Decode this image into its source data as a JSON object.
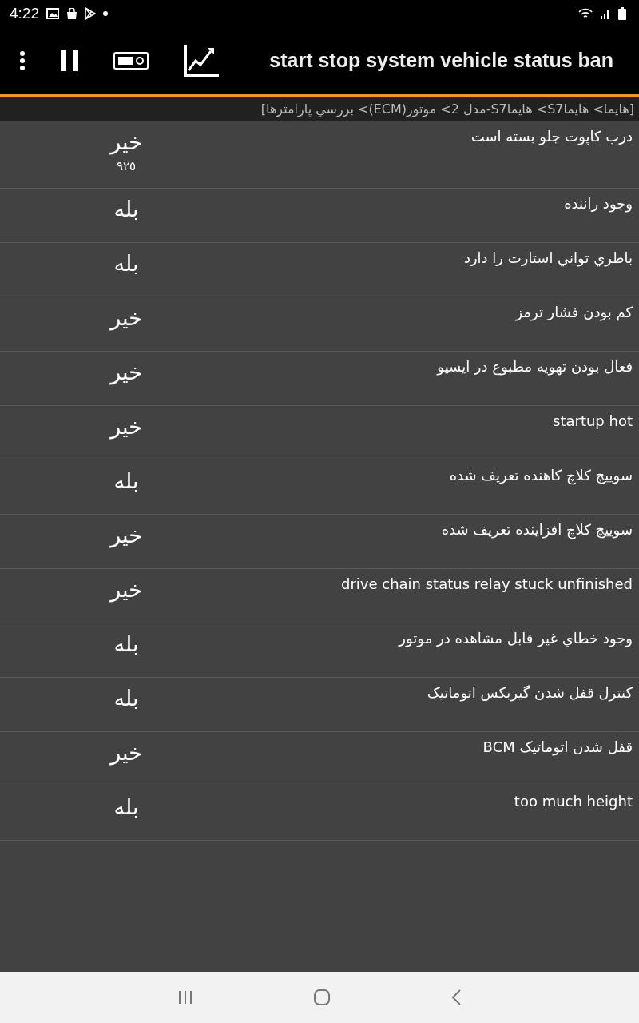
{
  "status_bar": {
    "time": "4:22"
  },
  "toolbar": {
    "title": "start stop system vehicle status ban"
  },
  "breadcrumb": "[هايما> هايماS7> هايماS7-مدل 2> موتور(ECM)> بررسي پارامترها]",
  "parameters": [
    {
      "name": "درب کاپوت جلو بسته است",
      "value": "خير",
      "sub": "٩٢٥"
    },
    {
      "name": "وجود راننده",
      "value": "بله"
    },
    {
      "name": "باطري تواني استارت را دارد",
      "value": "بله"
    },
    {
      "name": "کم بودن فشار ترمز",
      "value": "خير"
    },
    {
      "name": "فعال بودن تهويه مطبوع در ايسيو",
      "value": "خير"
    },
    {
      "name": "startup hot",
      "value": "خير"
    },
    {
      "name": "سوييچ کلاچ کاهنده تعريف شده",
      "value": "بله"
    },
    {
      "name": "سوييچ کلاچ افزاينده تعريف شده",
      "value": "خير"
    },
    {
      "name": "drive chain status relay stuck unfinished",
      "value": "خير"
    },
    {
      "name": "وجود خطاي غير قابل مشاهده در موتور",
      "value": "بله"
    },
    {
      "name": "کنترل قفل شدن گيربکس اتوماتيک",
      "value": "بله"
    },
    {
      "name": "قفل شدن اتوماتيک BCM",
      "value": "خير"
    },
    {
      "name": "too much height",
      "value": "بله"
    }
  ]
}
